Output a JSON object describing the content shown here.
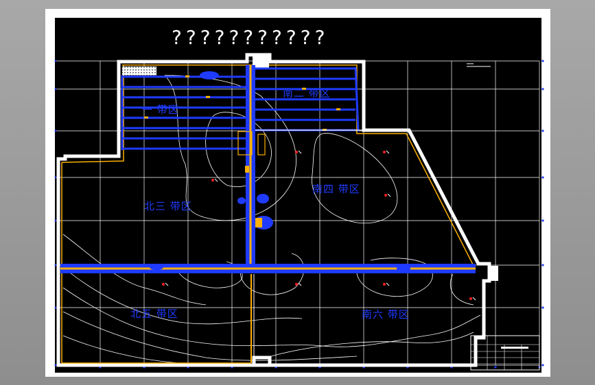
{
  "drawing": {
    "title": "???????????",
    "zones": [
      {
        "id": "north-1",
        "label": "一 带区"
      },
      {
        "id": "south-2",
        "label": "南二 带区"
      },
      {
        "id": "north-3",
        "label": "北三 带区"
      },
      {
        "id": "south-4",
        "label": "南四 带区"
      },
      {
        "id": "north-5",
        "label": "北五 带区"
      },
      {
        "id": "south-6",
        "label": "南六 带区"
      }
    ],
    "colors": {
      "background": "#000000",
      "sheet": "#ffffff",
      "grid": "#ffffff",
      "contour": "#ffffff",
      "roadway": "#1f3bff",
      "conveyor": "#ffb000",
      "boundary": "#ffb000",
      "boreholes": "#ff2020",
      "text": "#1f3bff"
    }
  }
}
